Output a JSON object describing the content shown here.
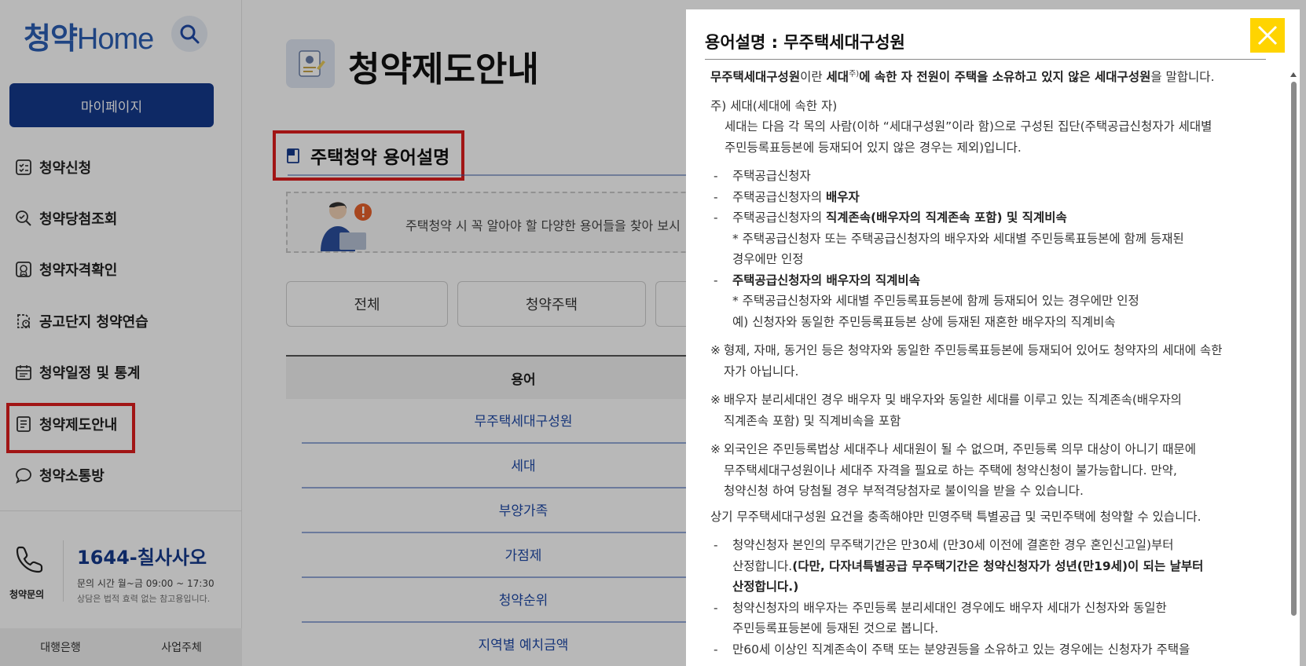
{
  "sidebar": {
    "logo_kor": "청약",
    "logo_home": "Home",
    "mypage": "마이페이지",
    "items": [
      {
        "label": "청약신청",
        "icon": "checklist-icon"
      },
      {
        "label": "청약당첨조회",
        "icon": "search-check-icon"
      },
      {
        "label": "청약자격확인",
        "icon": "badge-icon"
      },
      {
        "label": "공고단지 청약연습",
        "icon": "practice-icon"
      },
      {
        "label": "청약일정 및 통계",
        "icon": "calendar-icon"
      },
      {
        "label": "청약제도안내",
        "icon": "document-icon"
      },
      {
        "label": "청약소통방",
        "icon": "chat-icon"
      }
    ],
    "phone_number": "1644-칠사사오",
    "phone_label": "청약문의",
    "phone_hours": "문의 시간 월~금 09:00 ~ 17:30",
    "phone_note": "상담은 법적 효력 없는 참고용입니다.",
    "footer": [
      "대행은행",
      "사업주체"
    ]
  },
  "main": {
    "page_title": "청약제도안내",
    "section_title": "주택청약 용어설명",
    "intro_text": "주택청약 시 꼭 알아야 할 다양한 용어들을 찾아 보시",
    "tabs": [
      "전체",
      "청약주택",
      ""
    ],
    "table_header": "용어",
    "terms": [
      "무주택세대구성원",
      "세대",
      "부양가족",
      "가점제",
      "청약순위",
      "지역별 예치금액"
    ]
  },
  "modal": {
    "title": "용어설명 : 무주택세대구성원",
    "p1_a": "무주택세대구성원",
    "p1_b": "이란 ",
    "p1_c": "세대",
    "p1_sup": "주)",
    "p1_d": "에 속한 자 전원이 주택을 소유하고 있지 않은 세대구성원",
    "p1_e": "을 말합니다.",
    "note_head": "주) 세대(세대에 속한 자)",
    "note_l1": "세대는 다음 각 목의 사람(이하 “세대구성원”이라 함)으로 구성된 집단(주택공급신청자가 세대별",
    "note_l2": "주민등록표등본에 등재되어 있지 않은 경우는 제외)입니다.",
    "d1": "주택공급신청자",
    "d2_a": "주택공급신청자의 ",
    "d2_b": "배우자",
    "d3_a": "주택공급신청자의 ",
    "d3_b": "직계존속(배우자의 직계존속 포함) 및 직계비속",
    "d3_s1": "* 주택공급신청자 또는 주택공급신청자의 배우자와 세대별 주민등록표등본에 함께 등재된",
    "d3_s2": "경우에만 인정",
    "d4": "주택공급신청자의 배우자의 직계비속",
    "d4_s1": "* 주택공급신청자와 세대별 주민등록표등본에 함께 등재되어 있는 경우에만 인정",
    "d4_s2": "예) 신청자와 동일한 주민등록표등본 상에 등재된 재혼한 배우자의 직계비속",
    "n1_l1": "형제, 자매, 동거인 등은 청약자와 동일한 주민등록표등본에 등재되어 있어도 청약자의 세대에 속한",
    "n1_l2": "자가 아닙니다.",
    "n2_l1": "배우자 분리세대인 경우 배우자 및 배우자와 동일한 세대를 이루고 있는 직계존속(배우자의",
    "n2_l2": "직계존속 포함) 및 직계비속을 포함",
    "n3_l1": "외국인은 주민등록법상 세대주나 세대원이 될 수 없으며, 주민등록 의무 대상이 아니기 때문에",
    "n3_l2": "무주택세대구성원이나 세대주 자격을 필요로 하는 주택에 청약신청이 불가능합니다. 만약,",
    "n3_l3": "청약신청 하여 당첨될 경우 부적격당첨자로 불이익을 받을 수 있습니다.",
    "summary": "상기 무주택세대구성원 요건을 충족해야만 민영주택 특별공급 및 국민주택에 청약할 수 있습니다.",
    "e1_l1": "청약신청자 본인의 무주택기간은 만30세 (만30세 이전에 결혼한 경우 혼인신고일)부터",
    "e1_l2a": "산정합니다.",
    "e1_l2b": "(다만, 다자녀특별공급 무주택기간은 청약신청자가 성년(만19세)이 되는 날부터",
    "e1_l3": "산정합니다.)",
    "e2_l1": "청약신청자의 배우자는 주민등록 분리세대인 경우에도 배우자 세대가 신청자와 동일한",
    "e2_l2": "주민등록표등본에 등재된 것으로 봅니다.",
    "e3_l1": "만60세 이상인 직계존속이 주택 또는 분양권등을 소유하고 있는 경우에는 신청자가 주택을",
    "dash_mark": "-",
    "note_mark": "※"
  }
}
